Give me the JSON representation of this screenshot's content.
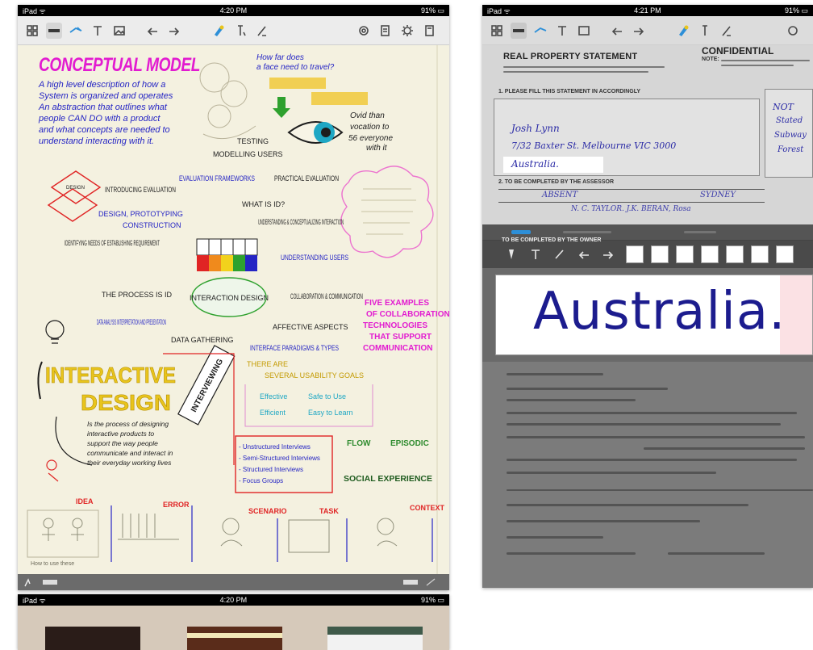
{
  "devices": {
    "left": {
      "status": {
        "carrier": "iPad ᯤ",
        "time": "4:20 PM",
        "battery": "91% ▭"
      },
      "toolbar_icons": [
        "grid-icon",
        "pen-icon",
        "highlighter-icon",
        "text-icon",
        "image-icon",
        "undo-icon",
        "redo-icon",
        "color-icon",
        "lasso-icon",
        "share-icon",
        "pages-icon",
        "settings-icon",
        "bookmark-icon"
      ]
    },
    "right": {
      "status": {
        "carrier": "iPad ᯤ",
        "time": "4:21 PM",
        "battery": "91% ▭"
      },
      "toolbar_icons": [
        "grid-icon",
        "pen-icon",
        "highlighter-icon",
        "text-icon",
        "image-icon",
        "undo-icon",
        "redo-icon",
        "color-icon",
        "lasso-icon",
        "share-icon"
      ]
    },
    "bottom": {
      "status": {
        "carrier": "iPad ᯤ",
        "time": "4:20 PM",
        "battery": "91% ▭"
      }
    }
  },
  "sketch_note": {
    "title": "CONCEPTUAL MODEL",
    "intro_lines": [
      "A high level description of how a",
      "System is organized and operates",
      "An abstraction that outlines what",
      "people CAN DO with a product",
      "and what concepts are needed to",
      "understand interacting with it."
    ],
    "top_question": [
      "How far does",
      "a face need to travel?"
    ],
    "labels": {
      "observe": "Ovid than",
      "observe2": "vocation to",
      "observe3": "56 everyone",
      "observe4": "with it",
      "testing": "TESTING",
      "modelling_users": "MODELLING USERS",
      "evaluation_frameworks": "EVALUATION FRAMEWORKS",
      "practical_evaluation": "PRACTICAL EVALUATION",
      "introducing_evaluation": "INTRODUCING EVALUATION",
      "what_is_id": "WHAT IS ID?",
      "design_prototyping": "DESIGN, PROTOTYPING",
      "construction": "CONSTRUCTION",
      "understanding_conceptualizing": "UNDERSTANDING & CONCEPTUALIZING INTERACTION",
      "identifying_needs": "IDENTIFYING NEEDS OF ESTABLISHING REQUIREMENT",
      "understanding_users": "UNDERSTANDING USERS",
      "process_id": "THE PROCESS IS ID",
      "interaction_design": "INTERACTION DESIGN",
      "collaboration": "COLLABORATION & COMMUNICATION",
      "five_examples": "FIVE EXAMPLES OF COLLABORATION TECHNOLOGIES THAT SUPPORT COMMUNICATION",
      "data_analysis": "DATA ANALYSIS INTERPRETATION AND PRESENTATION",
      "data_gathering": "DATA GATHERING",
      "affective_aspects": "AFFECTIVE ASPECTS",
      "interface_paradigms": "INTERFACE PARADIGMS & TYPES",
      "there_are": "THERE ARE",
      "several_usability": "SEVERAL USABILITY GOALS",
      "effective": "Effective",
      "efficient": "Efficient",
      "safe": "Safe to Use",
      "easy": "Easy to Learn",
      "interviewing": "INTERVIEWING",
      "interactive_design_1": "INTERACTIVE",
      "interactive_design_2": "DESIGN",
      "definition": [
        "Is the process of designing",
        "interactive products to",
        "support the way people",
        "communicate and interact in",
        "their everyday working lives"
      ],
      "interviews": [
        "- Unstructured Interviews",
        "- Semi-Structured Interviews",
        "- Structured Interviews",
        "- Focus Groups"
      ],
      "flow": "FLOW",
      "episodic": "EPISODIC",
      "social_experience": "SOCIAL EXPERIENCE",
      "idea": "IDEA",
      "error": "ERROR",
      "scenario": "SCENARIO",
      "task": "TASK",
      "context": "CONTEXT",
      "bottom_caption": "How to use these"
    }
  },
  "form": {
    "title": "REAL PROPERTY STATEMENT",
    "confidential": "CONFIDENTIAL",
    "note_label": "NOTE:",
    "section1": "1. PLEASE FILL THIS STATEMENT IN ACCORDINGLY",
    "hand_name": "Josh Lynn",
    "hand_address": "7/32 Baxter St. Melbourne VIC 3000",
    "hand_country": "Australia.",
    "section2": "2. TO BE COMPLETED BY THE ASSESSOR",
    "hand_assessor": "ABSENT",
    "hand_city": "SYDNEY",
    "hand_line": "N. C. TAYLOR. J.K. BERAN, Rosa",
    "side_hand": [
      "NOT",
      "Stated",
      "Subway",
      "Forest"
    ],
    "zoom_word": "Australia.",
    "zoom_strip_label": "TO BE COMPLETED BY THE OWNER"
  },
  "accent": {
    "magenta": "#e21bd0",
    "blue_ink": "#2424c4",
    "yellow": "#e8c41c",
    "red": "#e02424",
    "green": "#2e8b2e",
    "ink_black": "#1d1d1d"
  }
}
